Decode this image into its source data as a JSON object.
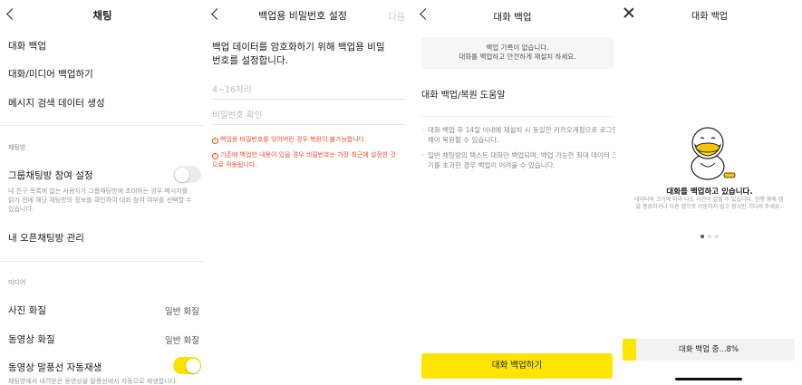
{
  "panel1": {
    "title": "채팅",
    "items": [
      {
        "label": "대화 백업"
      },
      {
        "label": "대화/미디어 백업하기"
      },
      {
        "label": "메시지 검색 데이터 생성"
      }
    ],
    "chatroom_section": "채팅방",
    "group_invite": {
      "label": "그룹채팅방 참여 설정",
      "enabled": false,
      "desc": "내 친구 목록에 없는 사용자가 그룹채팅방에 초대하는 경우 메시지를 읽기 전에 해당 채팅방의 정보를 확인하여 대화 참여 여부를 선택할 수 있습니다."
    },
    "open_chat": "내 오픈채팅방 관리",
    "media_section": "미디어",
    "photo_quality": {
      "label": "사진 화질",
      "value": "일반 화질"
    },
    "video_quality": {
      "label": "동영상 화질",
      "value": "일반 화질"
    },
    "video_autoplay": {
      "label": "동영상 말풍선 자동재생",
      "enabled": true,
      "desc": "채팅방에서 내려받은 동영상을 말풍선에서 자동으로 재생합니다."
    }
  },
  "panel2": {
    "title": "백업용 비밀번호 설정",
    "next_label": "다음",
    "heading": "백업 데이터를 암호화하기 위해 백업용 비밀번호를 설정합니다.",
    "password_placeholder": "4~16자리",
    "confirm_placeholder": "비밀번호 확인",
    "warning1": "백업용 비밀번호를 잊어버린 경우 복원이 불가능합니다.",
    "warning2": "기존에 백업한 내용이 있을 경우 비밀번호는 가장 최근에 설정한 것으로 적용됩니다.",
    "warning_color": "#e8502f"
  },
  "panel3": {
    "title": "대화 백업",
    "info_line1": "백업 기록이 없습니다.",
    "info_line2": "대화를 백업하고 안전하게 재설치 하세요.",
    "help": "대화 백업/복원 도움말",
    "bullet1": "대화 백업 후 14일 이내에 재설치 시 동일한 카카오계정으로 로그인해야 복원할 수 있습니다.",
    "bullet2": "일반 채팅방의 텍스트 대화만 백업되며, 백업 가능한 최대 데이터 크기를 초과한 경우 백업이 어려울 수 있습니다.",
    "button": "대화 백업하기",
    "button_color": "#fee500"
  },
  "panel4": {
    "title": "대화 백업",
    "main": "대화를 백업하고 있습니다.",
    "sub": "데이터의 크기에 따라 다소 시간이 걸릴 수 있습니다. 진행 중에 앱을 종료하거나 다른 앱으로 이동하지 말고 잠시만 기다려 주세요.",
    "pager": {
      "count": 3,
      "active": 0
    },
    "progress_text": "대화 백업 중...8%",
    "progress_fraction": 0.08
  }
}
